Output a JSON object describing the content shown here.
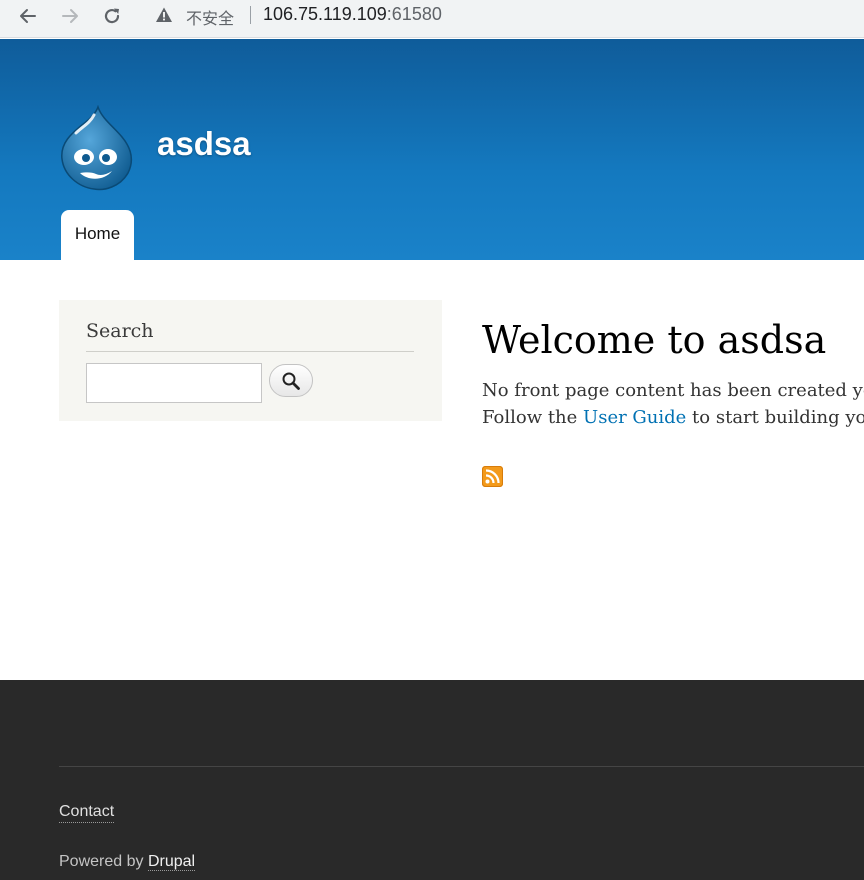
{
  "browser": {
    "security_label": "不安全",
    "url_host": "106.75.119.109",
    "url_port": ":61580"
  },
  "header": {
    "site_name": "asdsa",
    "nav": [
      {
        "label": "Home"
      }
    ]
  },
  "sidebar": {
    "search_block_title": "Search",
    "search_value": "",
    "search_button_icon": "search-icon"
  },
  "main": {
    "title": "Welcome to asdsa",
    "line1": "No front page content has been created yet.",
    "line2_before": "Follow the ",
    "line2_link": "User Guide",
    "line2_after": " to start building your site.",
    "feed_icon": "rss-icon"
  },
  "footer": {
    "contact_label": "Contact",
    "powered_by_text": "Powered by ",
    "powered_by_link": "Drupal"
  },
  "colors": {
    "header_top": "#0f5c9a",
    "header_bottom": "#1a82c9",
    "link": "#0071b3",
    "footer_bg": "#292929",
    "rss": "#f39a1b"
  }
}
